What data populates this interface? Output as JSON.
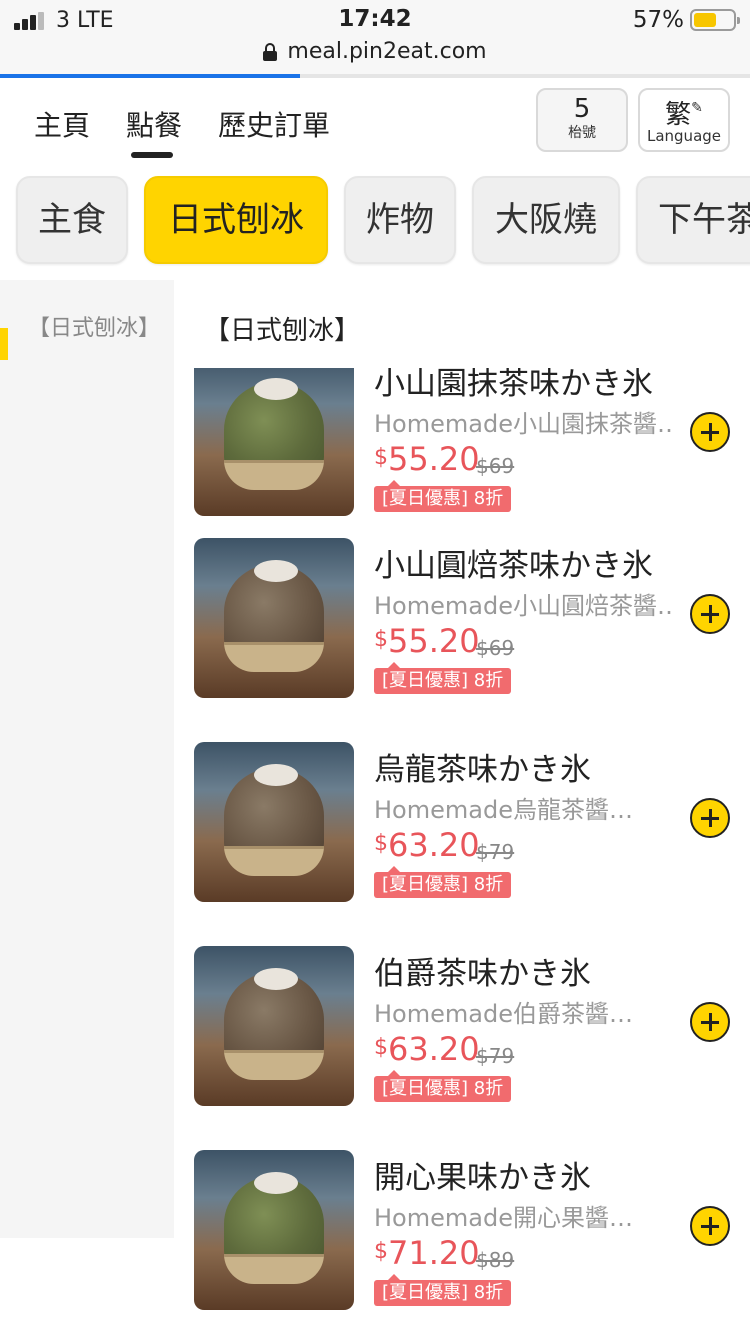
{
  "status_bar": {
    "carrier": "3  LTE",
    "time": "17:42",
    "battery_percent": "57%",
    "battery_level": 0.57,
    "signal_bars": 3
  },
  "browser": {
    "url": "meal.pin2eat.com",
    "load_progress": 0.4,
    "lock_icon": "lock-icon"
  },
  "nav": {
    "items": [
      "主頁",
      "點餐",
      "歷史訂單"
    ],
    "active_index": 1,
    "table_number": "5",
    "table_label": "枱號",
    "language_char": "繁",
    "language_label": "Language"
  },
  "categories": [
    {
      "label": "主食",
      "active": false
    },
    {
      "label": "日式刨冰",
      "active": true
    },
    {
      "label": "炸物",
      "active": false
    },
    {
      "label": "大阪燒",
      "active": false
    },
    {
      "label": "下午茶",
      "active": false
    }
  ],
  "sidebar": {
    "selected": "【日式刨冰】"
  },
  "section_title": "【日式刨冰】",
  "currency_symbol": "$",
  "items": [
    {
      "name": "小山園抹茶味かき氷",
      "desc": "Homemade小山園抹茶醬…",
      "price": "55.20",
      "original": "$69",
      "promo": "[夏日優惠] 8折",
      "ice": "green"
    },
    {
      "name": "小山圓焙茶味かき氷",
      "desc": "Homemade小山圓焙茶醬…",
      "price": "55.20",
      "original": "$69",
      "promo": "[夏日優惠] 8折",
      "ice": "brown"
    },
    {
      "name": "烏龍茶味かき氷",
      "desc": "Homemade烏龍茶醬…",
      "price": "63.20",
      "original": "$79",
      "promo": "[夏日優惠] 8折",
      "ice": "brown"
    },
    {
      "name": "伯爵茶味かき氷",
      "desc": "Homemade伯爵茶醬…",
      "price": "63.20",
      "original": "$79",
      "promo": "[夏日優惠] 8折",
      "ice": "brown"
    },
    {
      "name": "開心果味かき氷",
      "desc": "Homemade開心果醬…",
      "price": "71.20",
      "original": "$89",
      "promo": "[夏日優惠] 8折",
      "ice": "green"
    }
  ],
  "colors": {
    "accent": "#ffd400",
    "price": "#e8555a",
    "promo_bg": "#f16b6e",
    "progress": "#1a73e8"
  }
}
